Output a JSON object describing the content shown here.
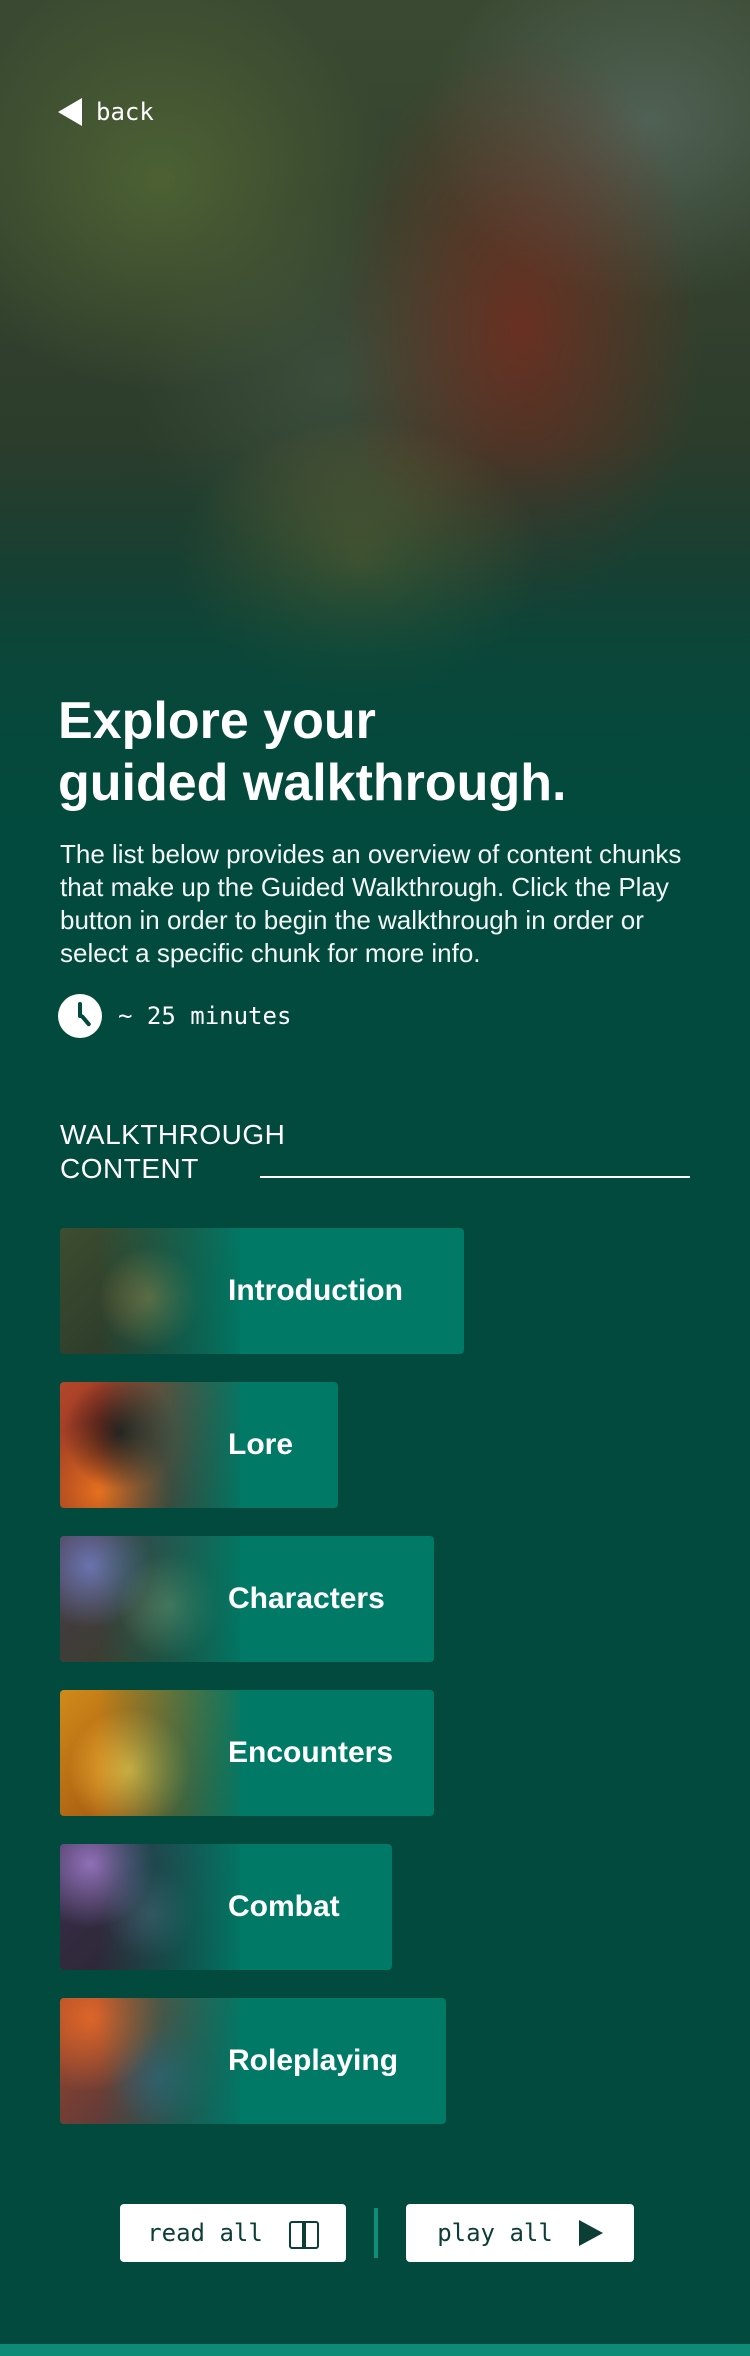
{
  "nav": {
    "back_label": "back"
  },
  "hero": {
    "title_line1": "Explore your",
    "title_line2": "guided walkthrough.",
    "description": "The list below provides an overview of content chunks that make up the Guided Walkthrough. Click the Play button in order to begin the walkthrough in order or select a specific chunk for more info.",
    "duration": "~ 25 minutes",
    "duration_icon": "clock-icon"
  },
  "section": {
    "title_line1": "WALKTHROUGH",
    "title_line2": "CONTENT"
  },
  "chunks": [
    {
      "label": "Introduction"
    },
    {
      "label": "Lore"
    },
    {
      "label": "Characters"
    },
    {
      "label": "Encounters"
    },
    {
      "label": "Combat"
    },
    {
      "label": "Roleplaying"
    }
  ],
  "actions": {
    "read_all_label": "read all",
    "read_all_icon": "book-icon",
    "play_all_label": "play all",
    "play_all_icon": "play-icon"
  },
  "colors": {
    "background": "#024a3d",
    "chunk_bg": "#007a67",
    "accent": "#0e8b76"
  }
}
